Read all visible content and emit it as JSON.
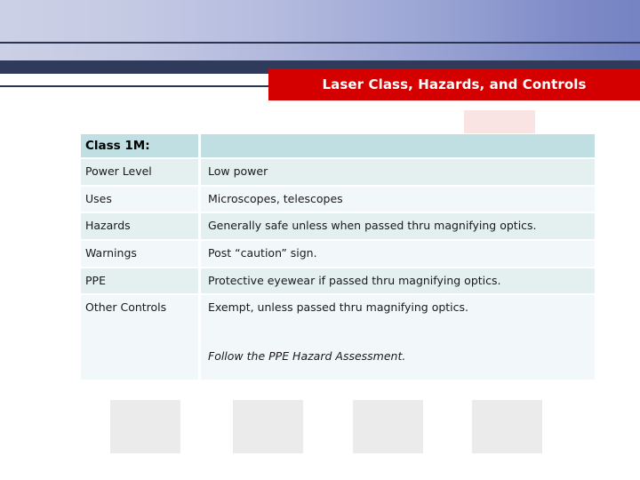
{
  "slide": {
    "title": "Laser Class, Hazards, and Controls"
  },
  "table": {
    "header": {
      "label": "Class 1M:",
      "value": ""
    },
    "rows": [
      {
        "label": "Power Level",
        "value": "Low power"
      },
      {
        "label": "Uses",
        "value": "Microscopes, telescopes"
      },
      {
        "label": "Hazards",
        "value": "Generally safe unless when passed thru magnifying optics."
      },
      {
        "label": "Warnings",
        "value": "Post “caution” sign."
      },
      {
        "label": "PPE",
        "value": "Protective eyewear if passed thru magnifying optics."
      },
      {
        "label": "Other Controls",
        "value": "Exempt, unless passed thru magnifying optics."
      }
    ],
    "footnote": "Follow the PPE Hazard Assessment."
  },
  "colors": {
    "banner_red": "#d40000",
    "navy_band": "#303b5c",
    "table_header": "#bfdfe2",
    "row_tint_a": "#e4eff0",
    "row_tint_b": "#f2f8f9",
    "pink_box": "#fae3e3",
    "gray_box": "#ebebeb"
  }
}
